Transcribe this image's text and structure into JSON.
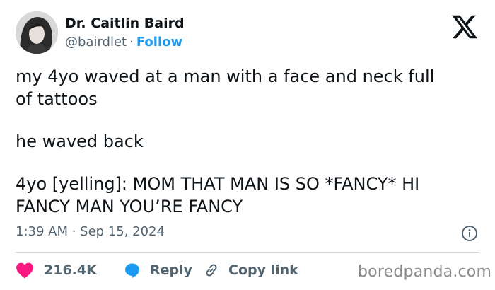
{
  "author": {
    "name": "Dr. Caitlin Baird",
    "handle": "@bairdlet",
    "separator": "·",
    "follow_label": "Follow"
  },
  "tweet": {
    "paragraphs": [
      {
        "lines": [
          "my 4yo waved at a man with a face and neck full",
          "of tattoos"
        ]
      },
      {
        "lines": [
          "he waved back"
        ]
      },
      {
        "lines": [
          "4yo [yelling]: MOM THAT MAN IS SO *FANCY* HI",
          "FANCY MAN YOU’RE FANCY"
        ]
      }
    ],
    "timestamp": "1:39 AM · Sep 15, 2024"
  },
  "actions": {
    "like_count": "216.4K",
    "reply_label": "Reply",
    "copy_label": "Copy link"
  },
  "watermark": "boredpanda.com",
  "colors": {
    "like": "#f91880",
    "reply": "#1d9bf0",
    "link": "#1d9bf0",
    "muted": "#536471",
    "text": "#0f1419"
  },
  "icons": {
    "brand": "x-logo-icon",
    "info": "info-icon",
    "like": "heart-icon",
    "reply": "reply-bubble-icon",
    "copy": "link-icon"
  }
}
